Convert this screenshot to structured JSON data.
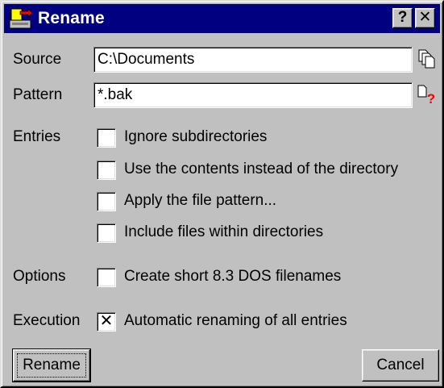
{
  "window": {
    "title": "Rename",
    "help_glyph": "?",
    "close_glyph": "✕",
    "app_icon": "rename-app-icon",
    "colors": {
      "titlebar": "#000080",
      "face": "#c0c0c0",
      "field": "#ffffff",
      "warning": "#ff0000"
    }
  },
  "source": {
    "label": "Source",
    "value": "C:\\Documents",
    "icon": "copy-pages-icon"
  },
  "pattern": {
    "label": "Pattern",
    "value": "*.bak",
    "icon": "document-question-icon"
  },
  "entries": {
    "label": "Entries",
    "options": [
      {
        "label": "Ignore subdirectories",
        "checked": false
      },
      {
        "label": "Use the contents instead of the directory",
        "checked": false
      },
      {
        "label": "Apply the file pattern...",
        "checked": false
      },
      {
        "label": "Include files within directories",
        "checked": false
      }
    ]
  },
  "options": {
    "label": "Options",
    "short_names": {
      "label": "Create short 8.3 DOS filenames",
      "checked": false
    }
  },
  "execution": {
    "label": "Execution",
    "auto_rename": {
      "label": "Automatic renaming of all entries",
      "checked": true
    }
  },
  "buttons": {
    "rename": "Rename",
    "cancel": "Cancel"
  }
}
